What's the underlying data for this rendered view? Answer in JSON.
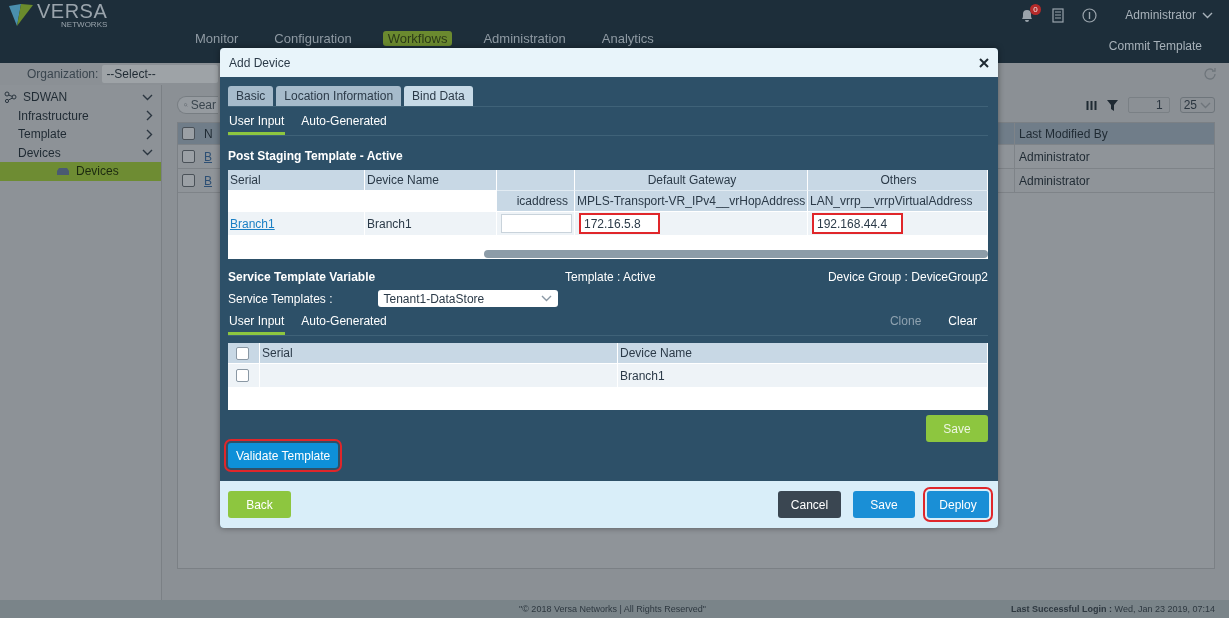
{
  "header": {
    "logo": {
      "name": "VERSA",
      "subtitle": "NETWORKS"
    },
    "notification_count": "0",
    "user": "Administrator",
    "nav": [
      {
        "label": "Monitor",
        "selected": false
      },
      {
        "label": "Configuration",
        "selected": false
      },
      {
        "label": "Workflows",
        "selected": true
      },
      {
        "label": "Administration",
        "selected": false
      },
      {
        "label": "Analytics",
        "selected": false
      }
    ],
    "action": "Commit Template"
  },
  "filter_bar": {
    "label": "Organization:",
    "value": "--Select--"
  },
  "sidebar": {
    "items": [
      {
        "label": "SDWAN",
        "expanded": true,
        "selected": false,
        "children": [
          {
            "label": "Infrastructure",
            "expanded": false,
            "selected": false
          },
          {
            "label": "Template",
            "expanded": false,
            "selected": false
          },
          {
            "label": "Devices",
            "expanded": true,
            "selected": false,
            "children": [
              {
                "label": "Devices",
                "selected": true
              }
            ]
          }
        ]
      }
    ]
  },
  "devices_table": {
    "search_placeholder": "Sear",
    "page": "1",
    "page_size": "25",
    "header_checked": false,
    "columns": [
      "N",
      "Last Modified By"
    ],
    "rows": [
      {
        "checked": false,
        "column_1": "B",
        "last_modified_by": "Administrator"
      },
      {
        "checked": false,
        "column_1": "B",
        "last_modified_by": "Administrator"
      }
    ]
  },
  "dialog": {
    "title": "Add Device",
    "tabs": [
      {
        "label": "Basic",
        "selected": false
      },
      {
        "label": "Location Information",
        "selected": false
      },
      {
        "label": "Bind Data",
        "selected": true
      }
    ],
    "post_staging": {
      "subtabs": [
        {
          "label": "User Input",
          "selected": true
        },
        {
          "label": "Auto-Generated",
          "selected": false
        }
      ],
      "title": "Post Staging Template - Active",
      "groups": [
        "Default Gateway",
        "Others"
      ],
      "columns": [
        "Serial",
        "Device Name",
        "icaddress",
        "MPLS-Transport-VR_IPv4__vrHopAddress",
        "LAN_vrrp__vrrpVirtualAddress"
      ],
      "rows": [
        {
          "serial": "Branch1",
          "device_name": "Branch1",
          "values": [
            {
              "highlighted": false
            },
            {
              "value": "172.16.5.8",
              "highlighted": true
            },
            {
              "value": "192.168.44.4",
              "highlighted": true
            }
          ]
        }
      ]
    },
    "service": {
      "title": "Service Template Variable",
      "template": "Template : Active",
      "device_group": "Device Group : DeviceGroup2",
      "select_label": "Service Templates :",
      "select_value": "Tenant1-DataStore",
      "subtabs": [
        {
          "label": "User Input",
          "selected": true
        },
        {
          "label": "Auto-Generated",
          "selected": false
        }
      ],
      "actions": [
        {
          "label": "Clone",
          "disabled": true
        },
        {
          "label": "Clear",
          "disabled": false
        }
      ],
      "header_checked": false,
      "columns": [
        "Serial",
        "Device Name"
      ],
      "rows": [
        {
          "checked": false,
          "device_name": "Branch1"
        }
      ],
      "save": "Save"
    },
    "validate": {
      "label": "Validate Template",
      "highlighted": true
    },
    "footer_buttons": [
      {
        "label": "Back",
        "kind": "back",
        "highlighted": false
      },
      {
        "label": "Cancel",
        "kind": "cancel",
        "highlighted": false
      },
      {
        "label": "Save",
        "kind": "save",
        "highlighted": false
      },
      {
        "label": "Deploy",
        "kind": "deploy",
        "highlighted": true
      }
    ]
  },
  "status_bar": {
    "copyright": "\"© 2018 Versa Networks | All Rights Reserved\"",
    "login_label": "Last Successful Login :",
    "login_time": "Wed, Jan 23 2019, 07:14"
  }
}
